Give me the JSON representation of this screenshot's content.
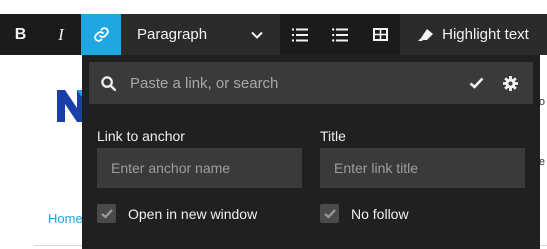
{
  "toolbar": {
    "bold_label": "B",
    "italic_label": "I",
    "format_select": "Paragraph",
    "highlight_label": "Highlight text",
    "active_color": "#1ea7e1"
  },
  "popover": {
    "search_placeholder": "Paste a link, or search",
    "anchor_label": "Link to anchor",
    "anchor_placeholder": "Enter anchor name",
    "title_label": "Title",
    "title_placeholder": "Enter link title",
    "new_window_label": "Open in new window",
    "nofollow_label": "No follow"
  },
  "background": {
    "home_link": "Home",
    "edge_char_1": "o",
    "edge_char_2": "e",
    "logo_color": "#1a3fa8"
  }
}
